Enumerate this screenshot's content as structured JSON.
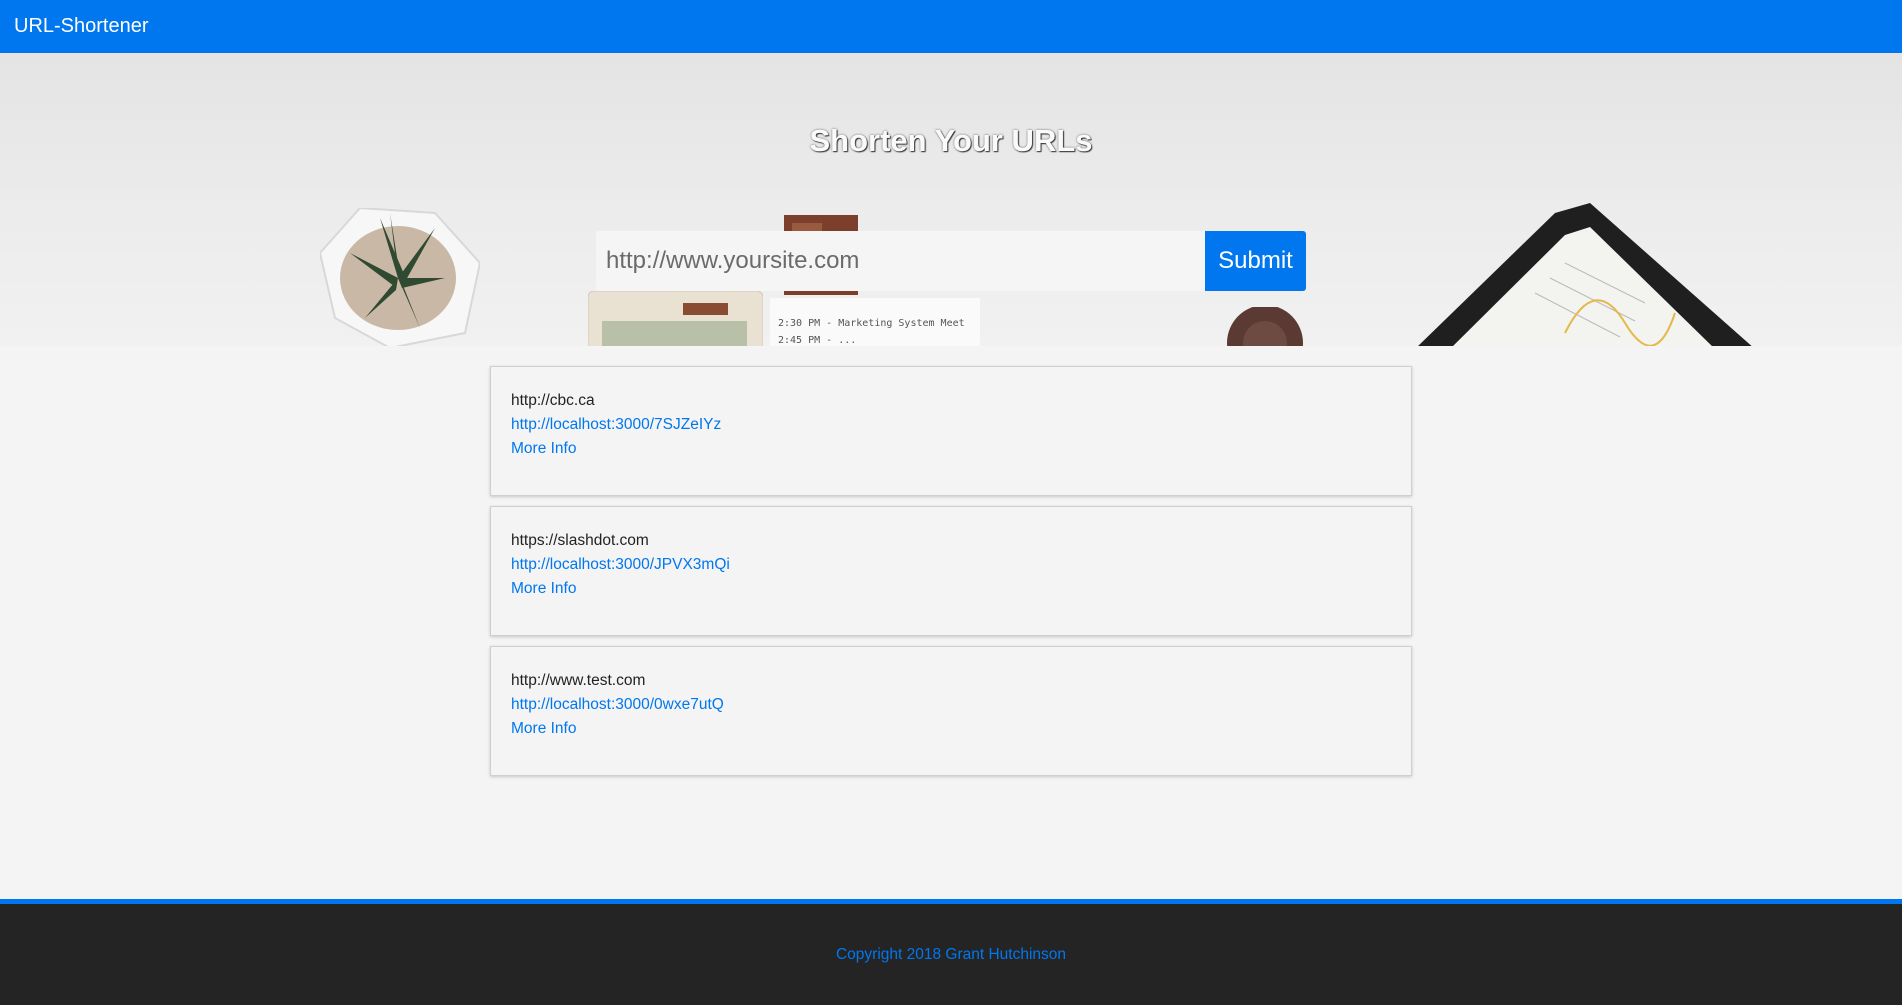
{
  "navbar": {
    "brand": "URL-Shortener"
  },
  "hero": {
    "title": "Shorten Your URLs",
    "input_placeholder": "http://www.yoursite.com",
    "input_value": "",
    "submit_label": "Submit"
  },
  "links": [
    {
      "original": "http://cbc.ca",
      "short": "http://localhost:3000/7SJZeIYz",
      "more_info": "More Info"
    },
    {
      "original": "https://slashdot.com",
      "short": "http://localhost:3000/JPVX3mQi",
      "more_info": "More Info"
    },
    {
      "original": "http://www.test.com",
      "short": "http://localhost:3000/0wxe7utQ",
      "more_info": "More Info"
    }
  ],
  "footer": {
    "copyright": "Copyright 2018 Grant Hutchinson"
  },
  "colors": {
    "accent": "#0077ee",
    "footer_bg": "#242424",
    "page_bg": "#f4f4f4"
  }
}
